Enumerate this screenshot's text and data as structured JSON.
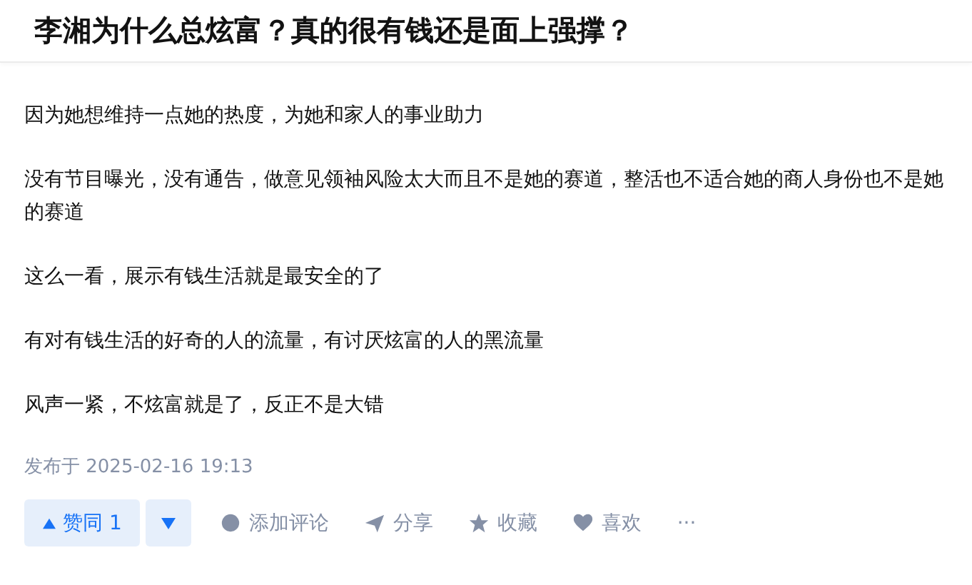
{
  "question": {
    "title": "李湘为什么总炫富？真的很有钱还是面上强撑？"
  },
  "answer": {
    "paragraphs": [
      "因为她想维持一点她的热度，为她和家人的事业助力",
      "没有节目曝光，没有通告，做意见领袖风险太大而且不是她的赛道，整活也不适合她的商人身份也不是她的赛道",
      "这么一看，展示有钱生活就是最安全的了",
      "有对有钱生活的好奇的人的流量，有讨厌炫富的人的黑流量",
      "风声一紧，不炫富就是了，反正不是大错"
    ],
    "published": "发布于 2025-02-16 19:13"
  },
  "actions": {
    "upvote": {
      "label": "赞同 1"
    },
    "items": [
      {
        "kind": "comment",
        "label": "添加评论"
      },
      {
        "kind": "share",
        "label": "分享"
      },
      {
        "kind": "collect",
        "label": "收藏"
      },
      {
        "kind": "like",
        "label": "喜欢"
      }
    ],
    "more": "···"
  }
}
